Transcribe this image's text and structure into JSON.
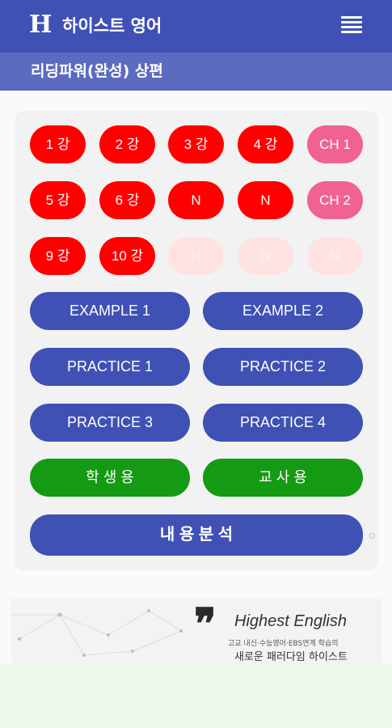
{
  "header": {
    "logo": "H",
    "title": "하이스트 영어"
  },
  "subheader": {
    "title": "리딩파워(완성) 상편"
  },
  "lessons": [
    {
      "label": "1 강",
      "state": "active"
    },
    {
      "label": "2 강",
      "state": "active"
    },
    {
      "label": "3 강",
      "state": "active"
    },
    {
      "label": "4 강",
      "state": "active"
    },
    {
      "label": "CH 1",
      "state": "chapter"
    },
    {
      "label": "5 강",
      "state": "active"
    },
    {
      "label": "6 강",
      "state": "active"
    },
    {
      "label": "N",
      "state": "active"
    },
    {
      "label": "N",
      "state": "active"
    },
    {
      "label": "CH 2",
      "state": "chapter"
    },
    {
      "label": "9 강",
      "state": "active"
    },
    {
      "label": "10 강",
      "state": "active"
    },
    {
      "label": "N",
      "state": "disabled"
    },
    {
      "label": "N",
      "state": "disabled"
    },
    {
      "label": "N",
      "state": "disabled"
    }
  ],
  "sections": {
    "example1": "EXAMPLE 1",
    "example2": "EXAMPLE 2",
    "practice1": "PRACTICE 1",
    "practice2": "PRACTICE 2",
    "practice3": "PRACTICE 3",
    "practice4": "PRACTICE 4",
    "student": "학 생 용",
    "teacher": "교 사 용",
    "analysis": "내 용 분 석"
  },
  "banner": {
    "brand": "Highest English",
    "tagline": "고교 내신·수능영어·EBS연계 학습의",
    "tagline2": "새로운 패러다임 하이스트"
  },
  "colors": {
    "primary": "#3f51b5",
    "secondary": "#5c6bc0",
    "lesson_active": "#ff0000",
    "lesson_chapter": "#f06292",
    "lesson_disabled": "#ffe3e3",
    "green": "#159a14"
  },
  "icons": {
    "menu": "hamburger-menu-icon"
  }
}
